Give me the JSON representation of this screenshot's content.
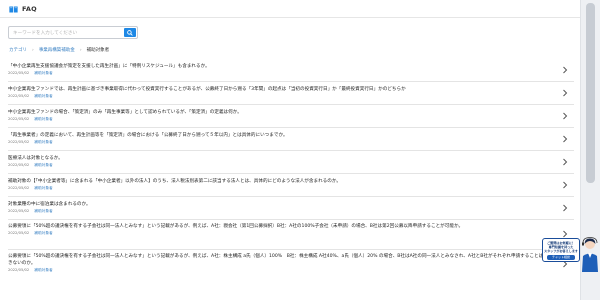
{
  "header": {
    "title": "FAQ"
  },
  "search": {
    "placeholder": "キーワードを入力してください"
  },
  "breadcrumb": {
    "items": [
      "カテゴリ",
      "事業再構築補助金",
      "補助対象者"
    ]
  },
  "faq": {
    "items": [
      {
        "question": "「中小企業再生支援協議会が策定を支援した再生計画」に「特例リスケジュール」も含まれるか。",
        "date": "2022/05/02",
        "category": "補助対象者"
      },
      {
        "question": "中小企業再生ファンドでは、再生計画に基づき事業取得に代わって投資実行することがあるが、公募終了日から遡る「3年間」の起点は「当初の投資実行日」か「最終投資実行日」かのどちらか",
        "date": "2022/05/02",
        "category": "補助対象者"
      },
      {
        "question": "中小企業再生ファンドの場合、「策定済」のみ「再生事業等」として認められているが、「策定済」の定義は何か。",
        "date": "2022/05/02",
        "category": "補助対象者"
      },
      {
        "question": "「再生事業者」の定義において、再生計画等を「策定済」の場合における「公募終了日から遡って５年以内」とは具体的にいつまでか。",
        "date": "2022/05/02",
        "category": "補助対象者"
      },
      {
        "question": "医療法人は対象となるか。",
        "date": "2022/05/02",
        "category": "補助対象者"
      },
      {
        "question": "補助対象の【「中小企業者等」に含まれる「中小企業者」以外の法人】のうち、法人税法別表第二に該当する法人とは、具体的にどのような法人が含まれるのか。",
        "date": "2022/05/02",
        "category": "補助対象者"
      },
      {
        "question": "対象業種の中に宿泊業は含まれるのか。",
        "date": "2022/05/02",
        "category": "補助対象者"
      },
      {
        "question": "公募要領に「50%超の議決権を有する子会社は同一法人とみなす」という記載があるが、例えば、A社：親会社（第1回公募採択）B社：A社の100%子会社（未申請）の場合、B社は第2回公募以降申請することが可能か。",
        "date": "2022/05/02",
        "category": "補助対象者"
      },
      {
        "question": "公募要領に「50%超の議決権を有する子会社は同一法人とみなす」という記載があるが、例えば、A社：株主構成 a氏（個人）100%　B社：株主構成 A社40%、a氏（個人）20% の場合、B社はA社の同一法人とみなされ、A社とB社がそれぞれ申請することはできないのか。",
        "date": "2022/05/02",
        "category": "補助対象者"
      }
    ]
  },
  "widget": {
    "line1": "ご質問はお気軽に！",
    "line2": "専門知識を持った",
    "line3": "スタッフがお答えします",
    "cta": "チャット相談"
  },
  "colors": {
    "accent": "#1e88e5",
    "link": "#3b82c4",
    "brand_dark": "#1a4d9a"
  }
}
